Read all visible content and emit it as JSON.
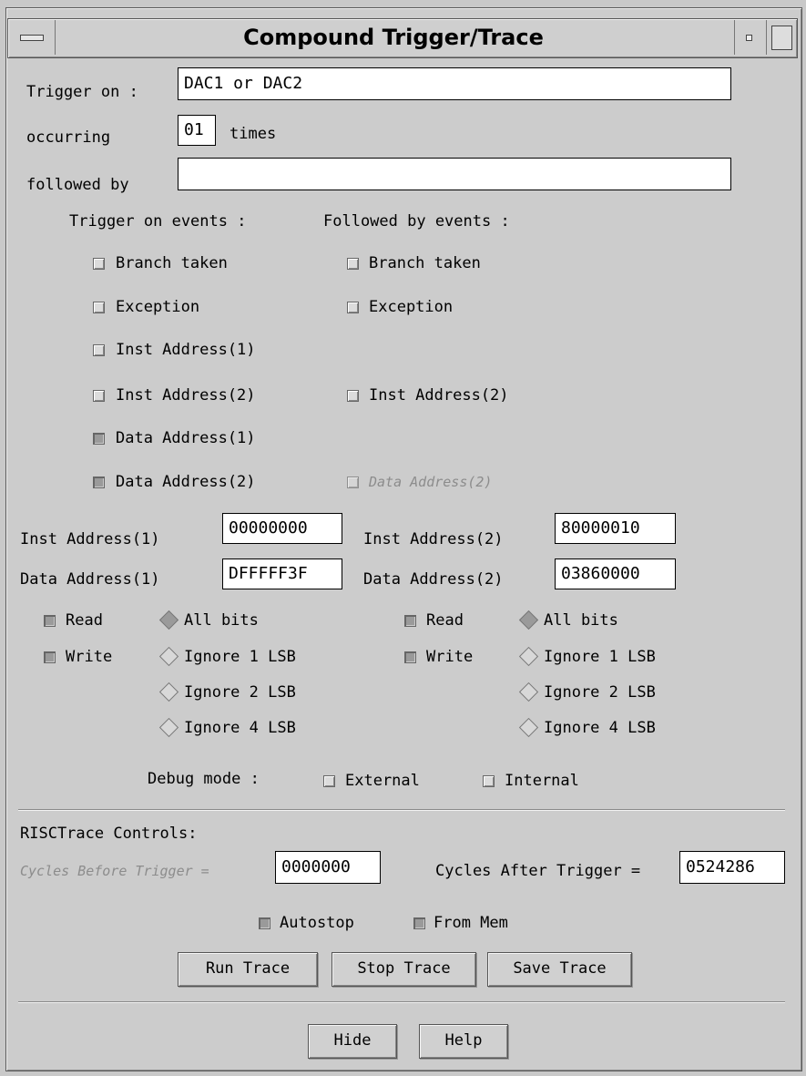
{
  "window": {
    "title": "Compound Trigger/Trace"
  },
  "trigger": {
    "trigger_on_label": "Trigger on :",
    "trigger_on_value": "DAC1 or DAC2",
    "occurring_label": "occurring",
    "occurring_value": "01",
    "times_label": "times",
    "followed_by_label": "followed by",
    "followed_by_value": ""
  },
  "events": {
    "trigger_header": "Trigger on events :",
    "followed_header": "Followed by events :",
    "trigger_items": [
      {
        "label": "Branch taken",
        "checked": false
      },
      {
        "label": "Exception",
        "checked": false
      },
      {
        "label": "Inst Address(1)",
        "checked": false
      },
      {
        "label": "Inst Address(2)",
        "checked": false
      },
      {
        "label": "Data Address(1)",
        "checked": true
      },
      {
        "label": "Data Address(2)",
        "checked": true
      }
    ],
    "followed_items": [
      {
        "label": "Branch taken",
        "checked": false
      },
      {
        "label": "Exception",
        "checked": false
      },
      {
        "label": "Inst Address(2)",
        "checked": false
      },
      {
        "label": "Data Address(2)",
        "checked": false,
        "disabled": true
      }
    ]
  },
  "addresses": {
    "inst1_label": "Inst Address(1)",
    "inst1_value": "00000000",
    "inst2_label": "Inst Address(2)",
    "inst2_value": "80000010",
    "data1_label": "Data Address(1)",
    "data1_value": "DFFFFF3F",
    "data2_label": "Data Address(2)",
    "data2_value": "03860000"
  },
  "access": {
    "left": {
      "read": "Read",
      "write": "Write",
      "read_checked": true,
      "write_checked": true
    },
    "right": {
      "read": "Read",
      "write": "Write",
      "read_checked": true,
      "write_checked": true
    },
    "mask_options": [
      "All bits",
      "Ignore 1 LSB",
      "Ignore 2 LSB",
      "Ignore 4 LSB"
    ],
    "left_selected": "All bits",
    "right_selected": "All bits"
  },
  "debug": {
    "label": "Debug mode :",
    "external": "External",
    "internal": "Internal"
  },
  "risctrace": {
    "header": "RISCTrace Controls:",
    "cycles_before_label": "Cycles Before Trigger =",
    "cycles_before_value": "0000000",
    "cycles_after_label": "Cycles After Trigger =",
    "cycles_after_value": "0524286",
    "autostop": "Autostop",
    "from_mem": "From Mem",
    "run_trace": "Run Trace",
    "stop_trace": "Stop Trace",
    "save_trace": "Save Trace"
  },
  "footer": {
    "hide": "Hide",
    "help": "Help"
  },
  "colors": {
    "window_bg": "#cccccc",
    "field_bg": "#ffffff",
    "disabled_text": "#8c8c8c"
  }
}
